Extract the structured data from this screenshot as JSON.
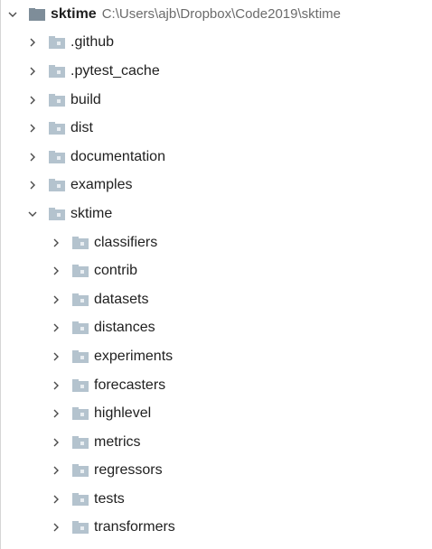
{
  "project": {
    "name": "sktime",
    "path": "C:\\Users\\ajb\\Dropbox\\Code2019\\sktime",
    "expanded": true
  },
  "root_children": [
    {
      "label": ".github",
      "expanded": false,
      "icon": "folder-icon"
    },
    {
      "label": ".pytest_cache",
      "expanded": false,
      "icon": "folder-icon"
    },
    {
      "label": "build",
      "expanded": false,
      "icon": "folder-icon"
    },
    {
      "label": "dist",
      "expanded": false,
      "icon": "folder-icon"
    },
    {
      "label": "documentation",
      "expanded": false,
      "icon": "folder-icon"
    },
    {
      "label": "examples",
      "expanded": false,
      "icon": "folder-icon"
    },
    {
      "label": "sktime",
      "expanded": true,
      "icon": "folder-icon"
    }
  ],
  "sktime_children": [
    {
      "label": "classifiers",
      "expanded": false,
      "icon": "folder-icon"
    },
    {
      "label": "contrib",
      "expanded": false,
      "icon": "folder-icon"
    },
    {
      "label": "datasets",
      "expanded": false,
      "icon": "folder-icon"
    },
    {
      "label": "distances",
      "expanded": false,
      "icon": "folder-icon"
    },
    {
      "label": "experiments",
      "expanded": false,
      "icon": "folder-icon"
    },
    {
      "label": "forecasters",
      "expanded": false,
      "icon": "folder-icon"
    },
    {
      "label": "highlevel",
      "expanded": false,
      "icon": "folder-icon"
    },
    {
      "label": "metrics",
      "expanded": false,
      "icon": "folder-icon"
    },
    {
      "label": "regressors",
      "expanded": false,
      "icon": "folder-icon"
    },
    {
      "label": "tests",
      "expanded": false,
      "icon": "folder-icon"
    },
    {
      "label": "transformers",
      "expanded": false,
      "icon": "folder-icon"
    }
  ],
  "colors": {
    "folder_dark": "#7e8d99",
    "folder_light": "#b4c3ce",
    "chevron": "#4a4a4a",
    "path_text": "#6b6b6b"
  }
}
